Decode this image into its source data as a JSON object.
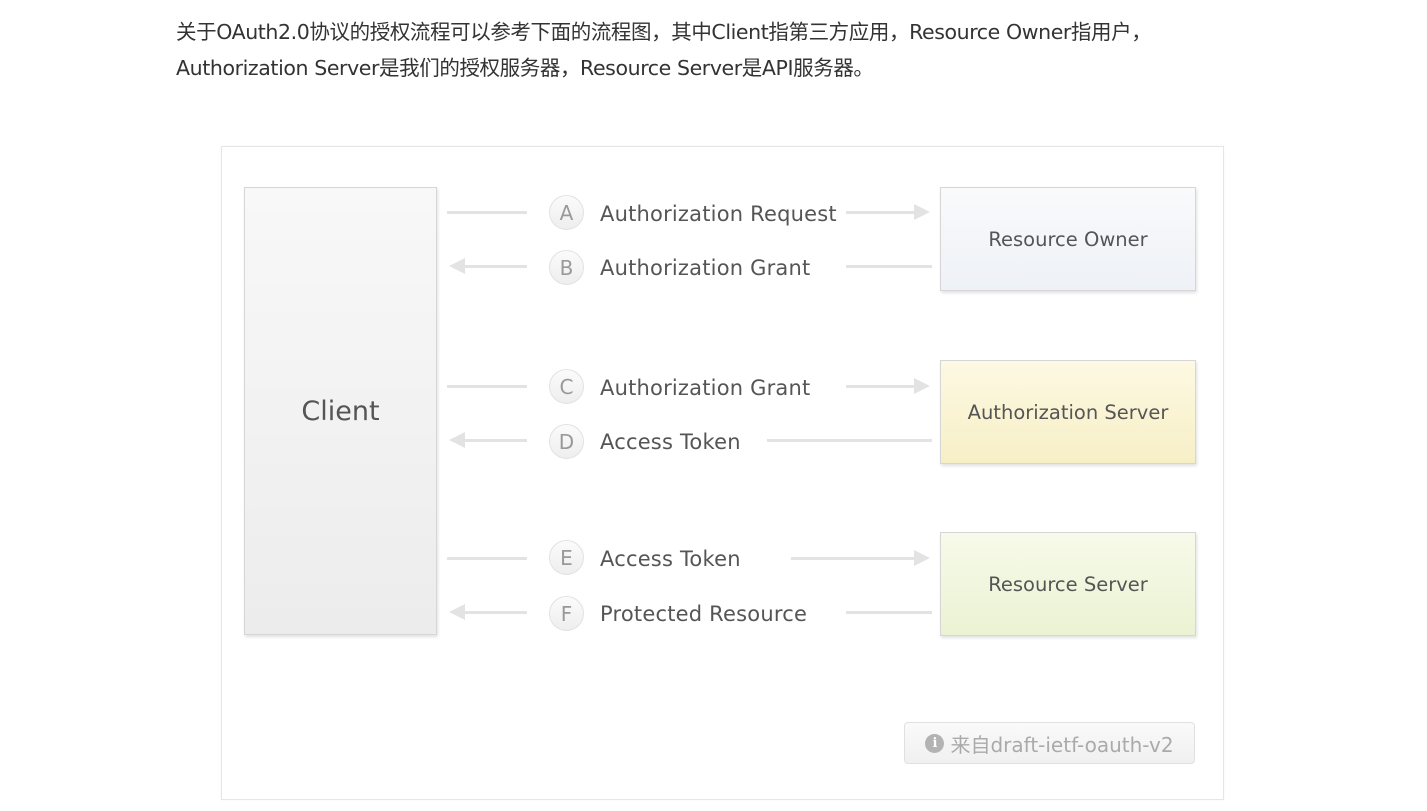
{
  "intro": {
    "line1": "关于OAuth2.0协议的授权流程可以参考下面的流程图，其中Client指第三方应用，Resource Owner指用户，",
    "line2": "Authorization Server是我们的授权服务器，Resource Server是API服务器。"
  },
  "diagram": {
    "client": "Client",
    "resource_owner": "Resource Owner",
    "authorization_server": "Authorization Server",
    "resource_server": "Resource Server",
    "steps": [
      {
        "letter": "A",
        "label": "Authorization Request",
        "direction": "right"
      },
      {
        "letter": "B",
        "label": "Authorization Grant",
        "direction": "left"
      },
      {
        "letter": "C",
        "label": "Authorization Grant",
        "direction": "right"
      },
      {
        "letter": "D",
        "label": "Access Token",
        "direction": "left"
      },
      {
        "letter": "E",
        "label": "Access Token",
        "direction": "right"
      },
      {
        "letter": "F",
        "label": "Protected Resource",
        "direction": "left"
      }
    ],
    "source": "来自draft-ietf-oauth-v2",
    "source_icon": "info-icon",
    "colors": {
      "resource_owner_bg": "#f3f5f9",
      "authorization_server_bg": "#faf3d4",
      "resource_server_bg": "#f1f6df",
      "client_bg": "#f2f2f2",
      "arrow": "#e3e3e3"
    }
  }
}
